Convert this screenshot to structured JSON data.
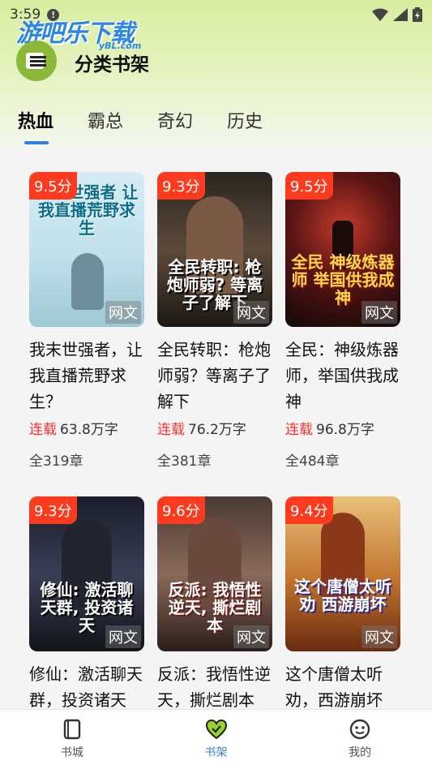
{
  "status_bar": {
    "time": "3:59"
  },
  "watermark": {
    "text": "游吧乐下载",
    "sub": "yBL.com"
  },
  "header": {
    "title": "分类书架"
  },
  "tabs": [
    {
      "label": "热血",
      "active": true
    },
    {
      "label": "霸总",
      "active": false
    },
    {
      "label": "奇幻",
      "active": false
    },
    {
      "label": "历史",
      "active": false
    }
  ],
  "books": [
    {
      "score": "9.5分",
      "tag": "网文",
      "cover_text": "我末世强者 让我直播荒野求生",
      "title": "我末世强者，让我直播荒野求生？",
      "status": "连载",
      "words": "63.8万字",
      "chapters": "全319章"
    },
    {
      "score": "9.3分",
      "tag": "网文",
      "cover_text": "全民转职: 枪炮师弱? 等离子了解下",
      "title": "全民转职：枪炮师弱？等离子了解下",
      "status": "连载",
      "words": "76.2万字",
      "chapters": "全381章"
    },
    {
      "score": "9.5分",
      "tag": "网文",
      "cover_text": "全民 神级炼器师 举国供我成神",
      "title": "全民：神级炼器师，举国供我成神",
      "status": "连载",
      "words": "96.8万字",
      "chapters": "全484章"
    },
    {
      "score": "9.3分",
      "tag": "网文",
      "cover_text": "修仙: 激活聊天群, 投资诸天",
      "title": "修仙：激活聊天群，投资诸天",
      "status": "",
      "words": "",
      "chapters": ""
    },
    {
      "score": "9.6分",
      "tag": "网文",
      "cover_text": "反派: 我悟性逆天, 撕烂剧本",
      "title": "反派：我悟性逆天，撕烂剧本",
      "status": "",
      "words": "",
      "chapters": ""
    },
    {
      "score": "9.4分",
      "tag": "网文",
      "cover_text": "这个唐僧太听劝 西游崩坏",
      "title": "这个唐僧太听劝，西游崩坏",
      "status": "",
      "words": "",
      "chapters": ""
    }
  ],
  "bottom_nav": [
    {
      "label": "书城",
      "icon": "book-icon",
      "active": false
    },
    {
      "label": "书架",
      "icon": "heart-icon",
      "active": true
    },
    {
      "label": "我的",
      "icon": "smile-icon",
      "active": false
    }
  ],
  "colors": {
    "accent": "#2b7de9",
    "score_bg": "#ff3b1f",
    "serial": "#ff3030",
    "header_bg": "#d8ee9e"
  }
}
